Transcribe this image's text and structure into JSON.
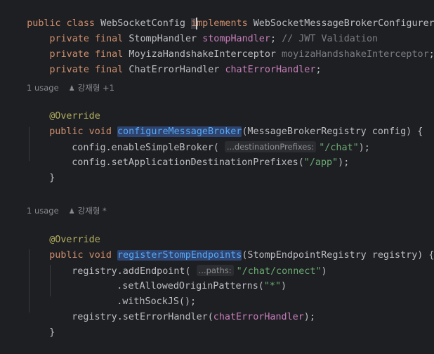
{
  "code": {
    "class_decl": {
      "kw1": "public class ",
      "name": "WebSocketConfig ",
      "impl_i": "i",
      "impl_rest": "mplements",
      "iface": " WebSocketMessageBrokerConfigurer {"
    },
    "fields": [
      {
        "kw": "    private final ",
        "type": "StompHandler ",
        "name": "stompHandler",
        "tail": "; ",
        "comment": "// JWT Validation"
      },
      {
        "kw": "    private final ",
        "type": "MoyizaHandshakeInterceptor ",
        "name": "moyizaHandshakeInterceptor",
        "tail": ";",
        "comment": ""
      },
      {
        "kw": "    private final ",
        "type": "ChatErrorHandler ",
        "name": "chatErrorHandler",
        "tail": ";",
        "comment": ""
      }
    ],
    "method1": {
      "usages": "1 usage",
      "author": "강재형 +1",
      "annotation": "@Override",
      "sig_kw": "public void ",
      "name": "configureMessageBroker",
      "params": "(MessageBrokerRegistry config) {",
      "line1_pre": "config.enableSimpleBroker(",
      "line1_hint": "...destinationPrefixes:",
      "line1_str": "\"/chat\"",
      "line1_post": ");",
      "line2_pre": "config.setApplicationDestinationPrefixes(",
      "line2_str": "\"/app\"",
      "line2_post": ");",
      "close": "}"
    },
    "method2": {
      "usages": "1 usage",
      "author": "강재형 *",
      "annotation": "@Override",
      "sig_kw": "public void ",
      "name": "registerStompEndpoints",
      "params": "(StompEndpointRegistry registry) {",
      "line1_pre": "registry.addEndpoint(",
      "line1_hint": "...paths:",
      "line1_str": "\"/chat/connect\"",
      "line1_post": ")",
      "line2_pre": ".setAllowedOriginPatterns(",
      "line2_str": "\"*\"",
      "line2_post": ")",
      "line3": ".withSockJS();",
      "line4_pre": "registry.setErrorHandler(",
      "line4_field": "chatErrorHandler",
      "line4_post": ");",
      "close": "}"
    }
  },
  "icons": {
    "user": "person-icon"
  },
  "colors": {
    "background": "#1e1f22",
    "keyword": "#cf8e6d",
    "string": "#6aab73",
    "field": "#c77dbb",
    "method": "#56a8f5",
    "annotation": "#b3ae60",
    "comment": "#7a7e85"
  }
}
